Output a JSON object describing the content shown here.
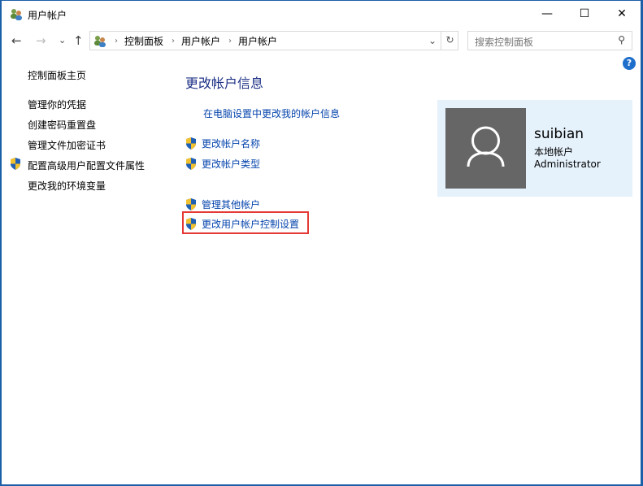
{
  "window": {
    "title": "用户帐户",
    "minimize": "—",
    "maximize": "☐",
    "close": "✕"
  },
  "nav": {
    "back": "←",
    "forward": "→",
    "recent": "⌄",
    "up": "↑",
    "breadcrumb": [
      "控制面板",
      "用户帐户",
      "用户帐户"
    ],
    "dropdown": "⌄",
    "refresh": "↻",
    "search_placeholder": "搜索控制面板",
    "search_icon": "⚲"
  },
  "help": "?",
  "sidebar": {
    "items": [
      {
        "label": "控制面板主页"
      },
      {
        "label": "管理你的凭据"
      },
      {
        "label": "创建密码重置盘"
      },
      {
        "label": "管理文件加密证书"
      },
      {
        "label": "配置高级用户配置文件属性",
        "shield": true
      },
      {
        "label": "更改我的环境变量"
      }
    ]
  },
  "main": {
    "heading": "更改帐户信息",
    "links": [
      "在电脑设置中更改我的帐户信息",
      "更改帐户名称",
      "更改帐户类型",
      "管理其他帐户",
      "更改用户帐户控制设置"
    ]
  },
  "account": {
    "name": "suibian",
    "type": "本地帐户",
    "role": "Administrator"
  }
}
